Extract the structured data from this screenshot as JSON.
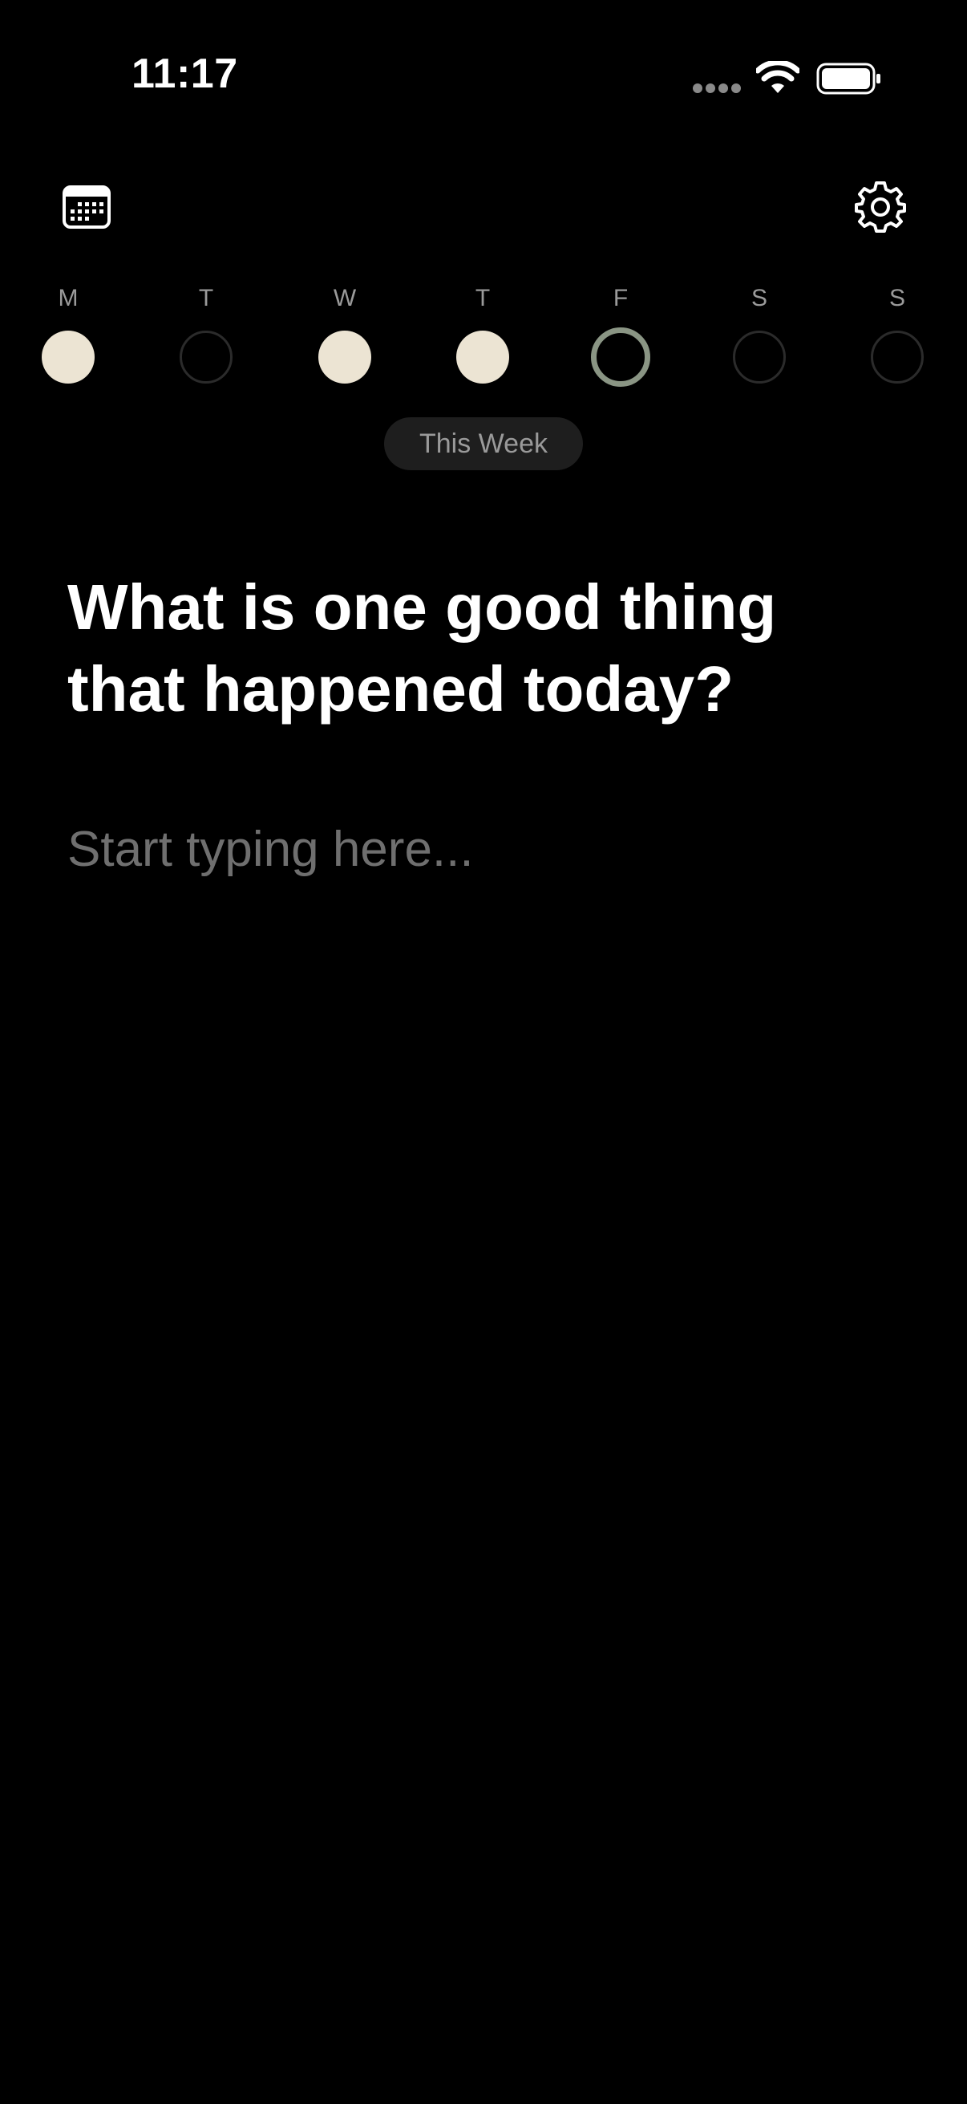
{
  "status_bar": {
    "time": "11:17"
  },
  "toolbar": {
    "calendar_icon": "calendar-icon",
    "settings_icon": "gear-icon"
  },
  "week": {
    "days": [
      {
        "letter": "M",
        "state": "filled"
      },
      {
        "letter": "T",
        "state": "empty"
      },
      {
        "letter": "W",
        "state": "filled"
      },
      {
        "letter": "T",
        "state": "filled"
      },
      {
        "letter": "F",
        "state": "today"
      },
      {
        "letter": "S",
        "state": "empty"
      },
      {
        "letter": "S",
        "state": "empty"
      }
    ],
    "label": "This Week"
  },
  "prompt": {
    "question": "What is one good thing that happened today?",
    "placeholder": "Start typing here..."
  },
  "colors": {
    "background": "#000000",
    "filled_day": "#ece4d3",
    "today_ring": "#8a9584",
    "empty_ring": "#2b2b2b",
    "muted_text": "#9a9a9a"
  }
}
